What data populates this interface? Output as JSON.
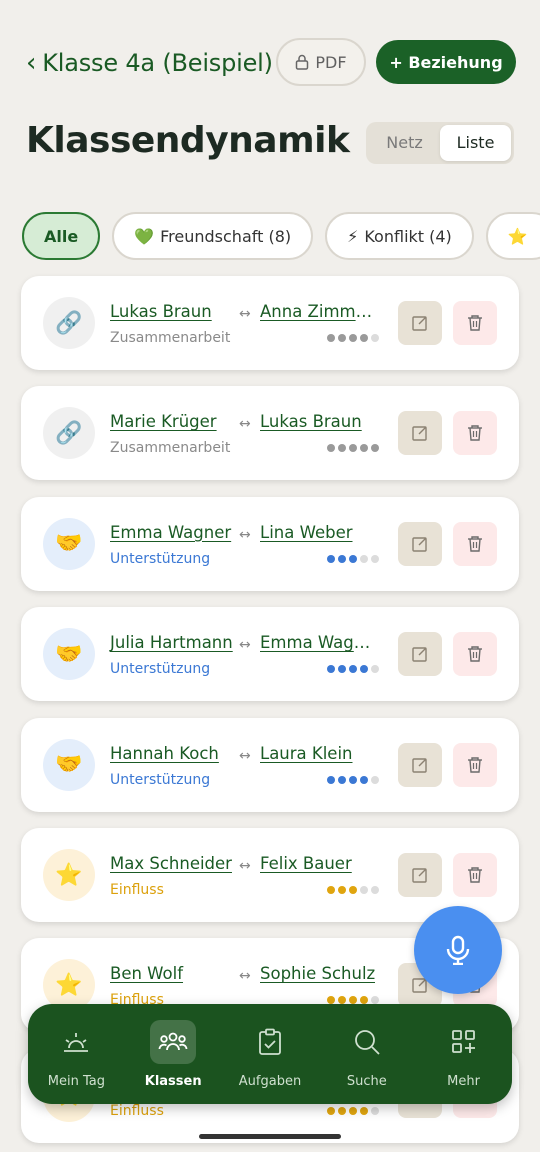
{
  "header": {
    "back_label": "Klasse 4a (Beispiel)",
    "pdf_label": "PDF",
    "add_label": "+ Beziehung"
  },
  "page": {
    "title": "Klassendynamik"
  },
  "view_toggle": {
    "options": [
      "Netz",
      "Liste"
    ],
    "active": "Liste"
  },
  "filters": [
    {
      "label": "Alle",
      "icon": ""
    },
    {
      "label": "Freundschaft (8)",
      "icon": "💚"
    },
    {
      "label": "Konflikt (4)",
      "icon": "⚡"
    },
    {
      "label": "",
      "icon": "⭐"
    }
  ],
  "relations": [
    {
      "person_a": "Lukas Braun",
      "person_b": "Anna Zimmer…",
      "type": "Zusammenarbeit",
      "icon": "link-icon",
      "emoji": "🔗",
      "strength": 4,
      "max": 5,
      "color": "#8a8a8a",
      "dot_color": "#9a9a9a"
    },
    {
      "person_a": "Marie Krüger",
      "person_b": "Lukas Braun",
      "type": "Zusammenarbeit",
      "icon": "link-icon",
      "emoji": "🔗",
      "strength": 5,
      "max": 5,
      "color": "#8a8a8a",
      "dot_color": "#9a9a9a"
    },
    {
      "person_a": "Emma Wagner",
      "person_b": "Lina Weber",
      "type": "Unterstützung",
      "icon": "handshake-icon",
      "emoji": "🤝",
      "strength": 3,
      "max": 5,
      "color": "#3b78d4",
      "dot_color": "#3b78d4"
    },
    {
      "person_a": "Julia Hartmann",
      "person_b": "Emma Wagner",
      "type": "Unterstützung",
      "icon": "handshake-icon",
      "emoji": "🤝",
      "strength": 4,
      "max": 5,
      "color": "#3b78d4",
      "dot_color": "#3b78d4"
    },
    {
      "person_a": "Hannah Koch",
      "person_b": "Laura Klein",
      "type": "Unterstützung",
      "icon": "handshake-icon",
      "emoji": "🤝",
      "strength": 4,
      "max": 5,
      "color": "#3b78d4",
      "dot_color": "#3b78d4"
    },
    {
      "person_a": "Max Schneider",
      "person_b": "Felix Bauer",
      "type": "Einfluss",
      "icon": "star-icon",
      "emoji": "⭐",
      "strength": 3,
      "max": 5,
      "color": "#dca10d",
      "dot_color": "#e0a50f"
    },
    {
      "person_a": "Ben Wolf",
      "person_b": "Sophie Schulz",
      "type": "Einfluss",
      "icon": "star-icon",
      "emoji": "⭐",
      "strength": 4,
      "max": 5,
      "color": "#dca10d",
      "dot_color": "#e0a50f"
    },
    {
      "person_a": "",
      "person_b": "",
      "type": "Einfluss",
      "icon": "star-icon",
      "emoji": "⭐",
      "strength": 4,
      "max": 5,
      "color": "#dca10d",
      "dot_color": "#e0a50f"
    }
  ],
  "nav": [
    {
      "label": "Mein Tag",
      "icon": "sunrise-icon",
      "active": false
    },
    {
      "label": "Klassen",
      "icon": "group-icon",
      "active": true
    },
    {
      "label": "Aufgaben",
      "icon": "clipboard-icon",
      "active": false
    },
    {
      "label": "Suche",
      "icon": "search-icon",
      "active": false
    },
    {
      "label": "Mehr",
      "icon": "grid-plus-icon",
      "active": false
    }
  ],
  "colors": {
    "brand": "#1b6127",
    "nav_bg": "#1b531f",
    "mic": "#4a8ff0"
  }
}
